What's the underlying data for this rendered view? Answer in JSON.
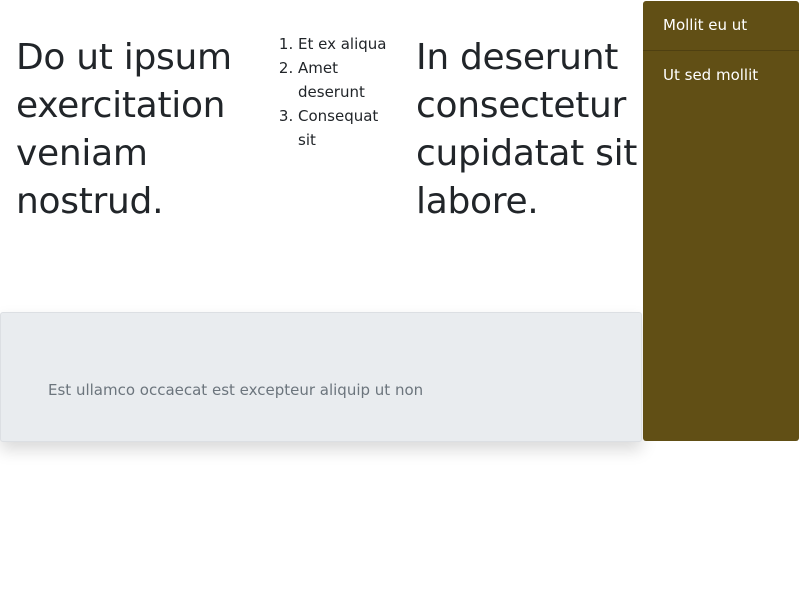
{
  "headings": {
    "left": "Do ut ipsum exercitation veniam nostrud.",
    "right": "In deserunt consectetur cupidatat sit labore."
  },
  "list": {
    "items": [
      "Et ex aliqua",
      "Amet deserunt",
      "Consequat sit"
    ]
  },
  "info_box": {
    "text": "Est ullamco occaecat est excepteur aliquip ut non"
  },
  "side_menu": {
    "items": [
      {
        "label": "Mollit eu ut"
      },
      {
        "label": "Ut sed mollit"
      }
    ]
  },
  "colors": {
    "menu_background": "#614f15",
    "info_background": "#e9ecef",
    "text": "#212529",
    "muted_text": "#6c757d"
  }
}
